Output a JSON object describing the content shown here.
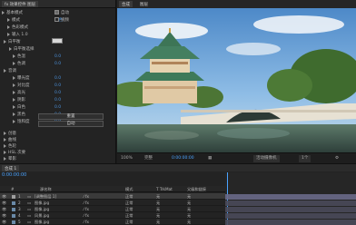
{
  "effect_panel": {
    "tab_label": "fx 效果控件 图层",
    "rows": [
      {
        "label": "基本模式",
        "indent": 2
      },
      {
        "label": "模式",
        "value": "颜色",
        "indent": 8
      },
      {
        "label": "色彩模式",
        "indent": 8
      },
      {
        "label": "输入 1.0",
        "indent": 8
      },
      {
        "label": "白平衡",
        "indent": 4
      },
      {
        "label": "白平衡选择",
        "indent": 10
      },
      {
        "label": "色温",
        "value": "0.0",
        "indent": 14
      },
      {
        "label": "色调",
        "value": "0.0",
        "indent": 14
      },
      {
        "label": "音调",
        "indent": 4
      },
      {
        "label": "曝光度",
        "value": "0.0",
        "indent": 14
      },
      {
        "label": "对比度",
        "value": "0.0",
        "indent": 14
      },
      {
        "label": "高光",
        "value": "0.0",
        "indent": 14
      },
      {
        "label": "阴影",
        "value": "0.0",
        "indent": 14
      },
      {
        "label": "白色",
        "value": "0.0",
        "indent": 14
      },
      {
        "label": "黑色",
        "value": "0.0",
        "indent": 14
      },
      {
        "label": "饱和度",
        "value": "0.0",
        "indent": 14
      }
    ],
    "checkbox_auto": "自动",
    "checkbox_video": "视频",
    "reset_button": "重置",
    "auto_button": "自动",
    "bottom_rows": [
      "创意",
      "曲线",
      "色轮",
      "HSL 次要",
      "晕影"
    ]
  },
  "viewer": {
    "tabs": [
      "合成",
      "图层"
    ],
    "zoom": "100%",
    "quality": "完整",
    "time": "0:00:00:00",
    "camera": "活动摄像机",
    "views": "1个"
  },
  "tooltip": "切换透明网格",
  "timeline": {
    "tab_label": "合成 1",
    "time_display": "0:00:00:00",
    "headers": [
      "#",
      "源名称",
      "模式",
      "T TrkMat",
      "父级和链接"
    ],
    "layers": [
      {
        "index": "1",
        "name": "[调整图层 1]",
        "mode": "正常",
        "trk": "无",
        "parent": "无",
        "color": "#a0a0a0",
        "selected": true
      },
      {
        "index": "2",
        "name": "图像.jpg",
        "mode": "正常",
        "trk": "无",
        "parent": "无",
        "color": "#6a8aa8",
        "selected": false
      },
      {
        "index": "3",
        "name": "图像.jpg",
        "mode": "正常",
        "trk": "无",
        "parent": "无",
        "color": "#6a8aa8",
        "selected": false
      },
      {
        "index": "4",
        "name": "风景.jpg",
        "mode": "正常",
        "trk": "无",
        "parent": "无",
        "color": "#6a8aa8",
        "selected": false
      },
      {
        "index": "5",
        "name": "图像.jpg",
        "mode": "正常",
        "trk": "无",
        "parent": "无",
        "color": "#6a8aa8",
        "selected": false
      }
    ]
  }
}
